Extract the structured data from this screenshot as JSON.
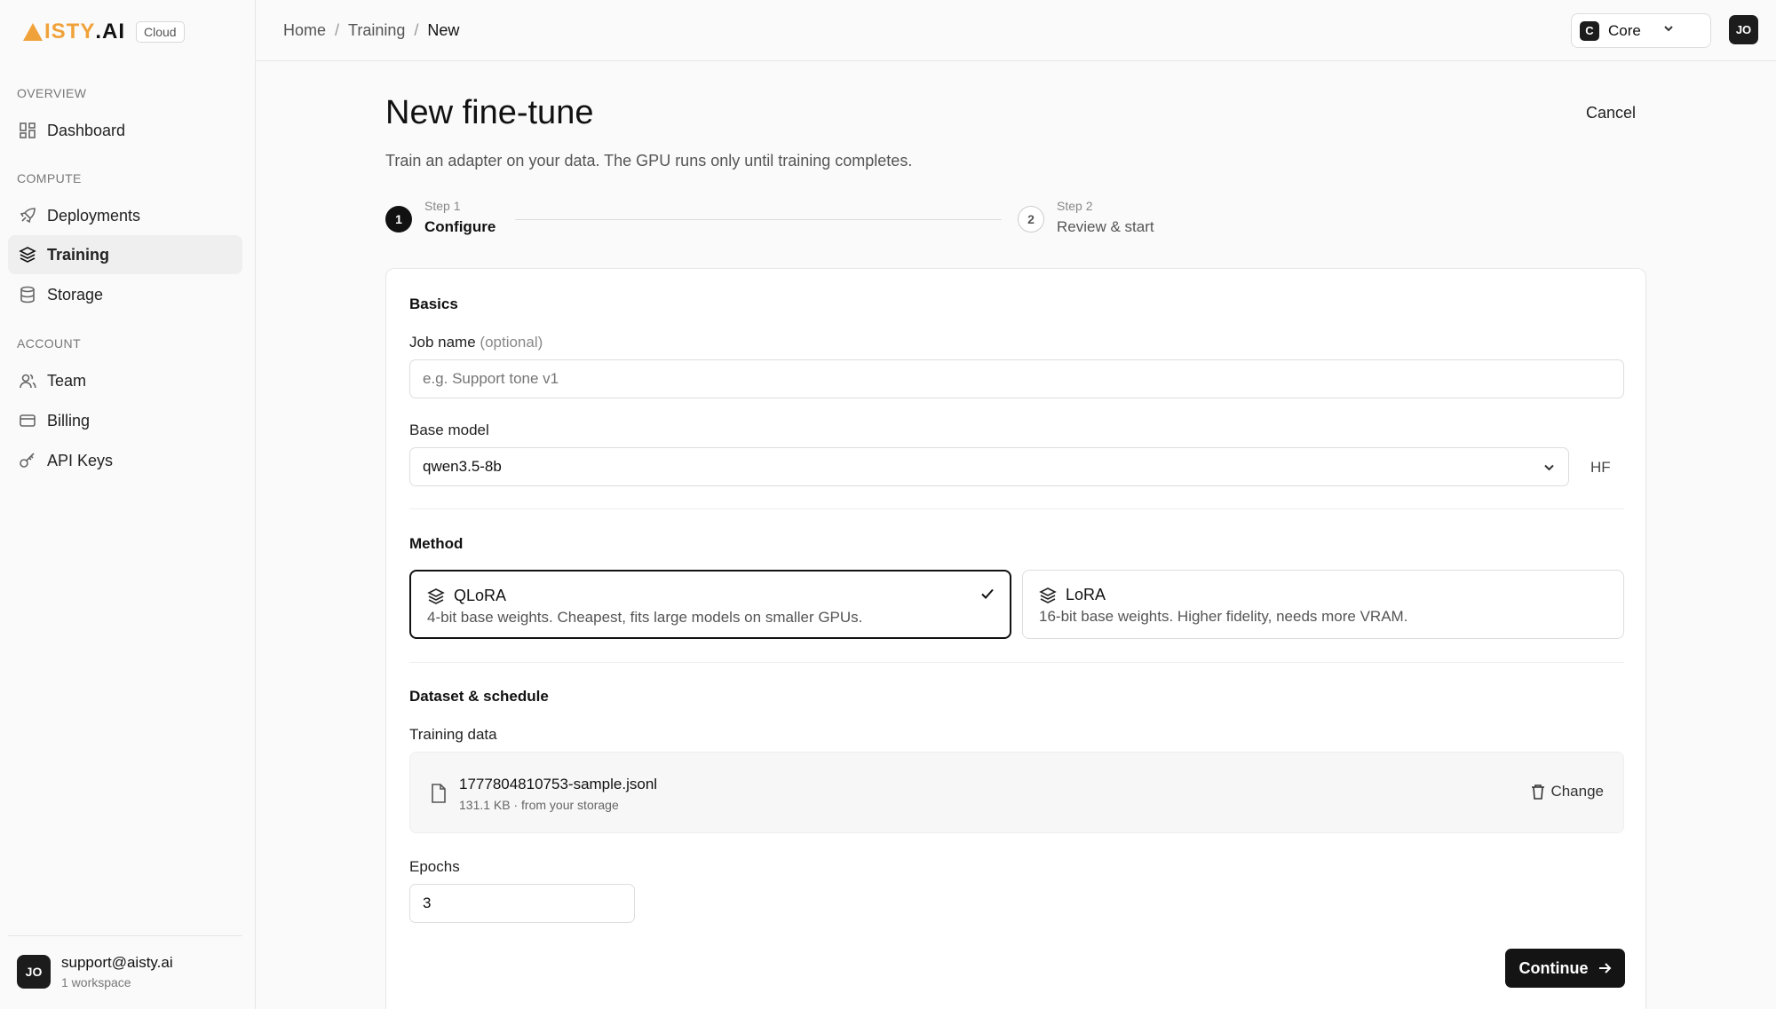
{
  "brand": {
    "logo_prefix": "ISTY",
    "logo_suffix": ".AI",
    "badge": "Cloud",
    "accent_color": "#f0a23a"
  },
  "sidebar": {
    "sections": [
      "OVERVIEW",
      "COMPUTE",
      "ACCOUNT"
    ],
    "items": [
      {
        "label": "Dashboard",
        "icon": "dashboard-icon"
      },
      {
        "label": "Deployments",
        "icon": "rocket-icon"
      },
      {
        "label": "Training",
        "icon": "layers-icon",
        "active": true
      },
      {
        "label": "Storage",
        "icon": "database-icon"
      },
      {
        "label": "Team",
        "icon": "users-icon"
      },
      {
        "label": "Billing",
        "icon": "credit-card-icon"
      },
      {
        "label": "API Keys",
        "icon": "key-icon"
      }
    ],
    "footer": {
      "avatar": "JO",
      "email": "support@aisty.ai",
      "workspaces": "1 workspace"
    }
  },
  "header": {
    "breadcrumb": [
      "Home",
      "Training",
      "New"
    ],
    "workspace": {
      "badge": "C",
      "name": "Core"
    },
    "avatar": "JO"
  },
  "page": {
    "title": "New fine-tune",
    "cancel": "Cancel",
    "subtitle": "Train an adapter on your data. The GPU runs only until training completes."
  },
  "steps": [
    {
      "num": "1",
      "small": "Step 1",
      "label": "Configure",
      "active": true
    },
    {
      "num": "2",
      "small": "Step 2",
      "label": "Review & start",
      "active": false
    }
  ],
  "form": {
    "basics_title": "Basics",
    "job_name_label": "Job name",
    "job_name_optional": "(optional)",
    "job_name_placeholder": "e.g. Support tone v1",
    "base_model_label": "Base model",
    "base_model_value": "qwen3.5-8b",
    "hf_label": "HF",
    "method_title": "Method",
    "methods": [
      {
        "name": "QLoRA",
        "desc": "4-bit base weights. Cheapest, fits large models on smaller GPUs.",
        "selected": true
      },
      {
        "name": "LoRA",
        "desc": "16-bit base weights. Higher fidelity, needs more VRAM.",
        "selected": false
      }
    ],
    "dataset_title": "Dataset & schedule",
    "training_data_label": "Training data",
    "file_name": "1777804810753-sample.jsonl",
    "file_meta": "131.1 KB · from your storage",
    "change_label": "Change",
    "epochs_label": "Epochs",
    "epochs_value": "3",
    "continue_label": "Continue"
  }
}
